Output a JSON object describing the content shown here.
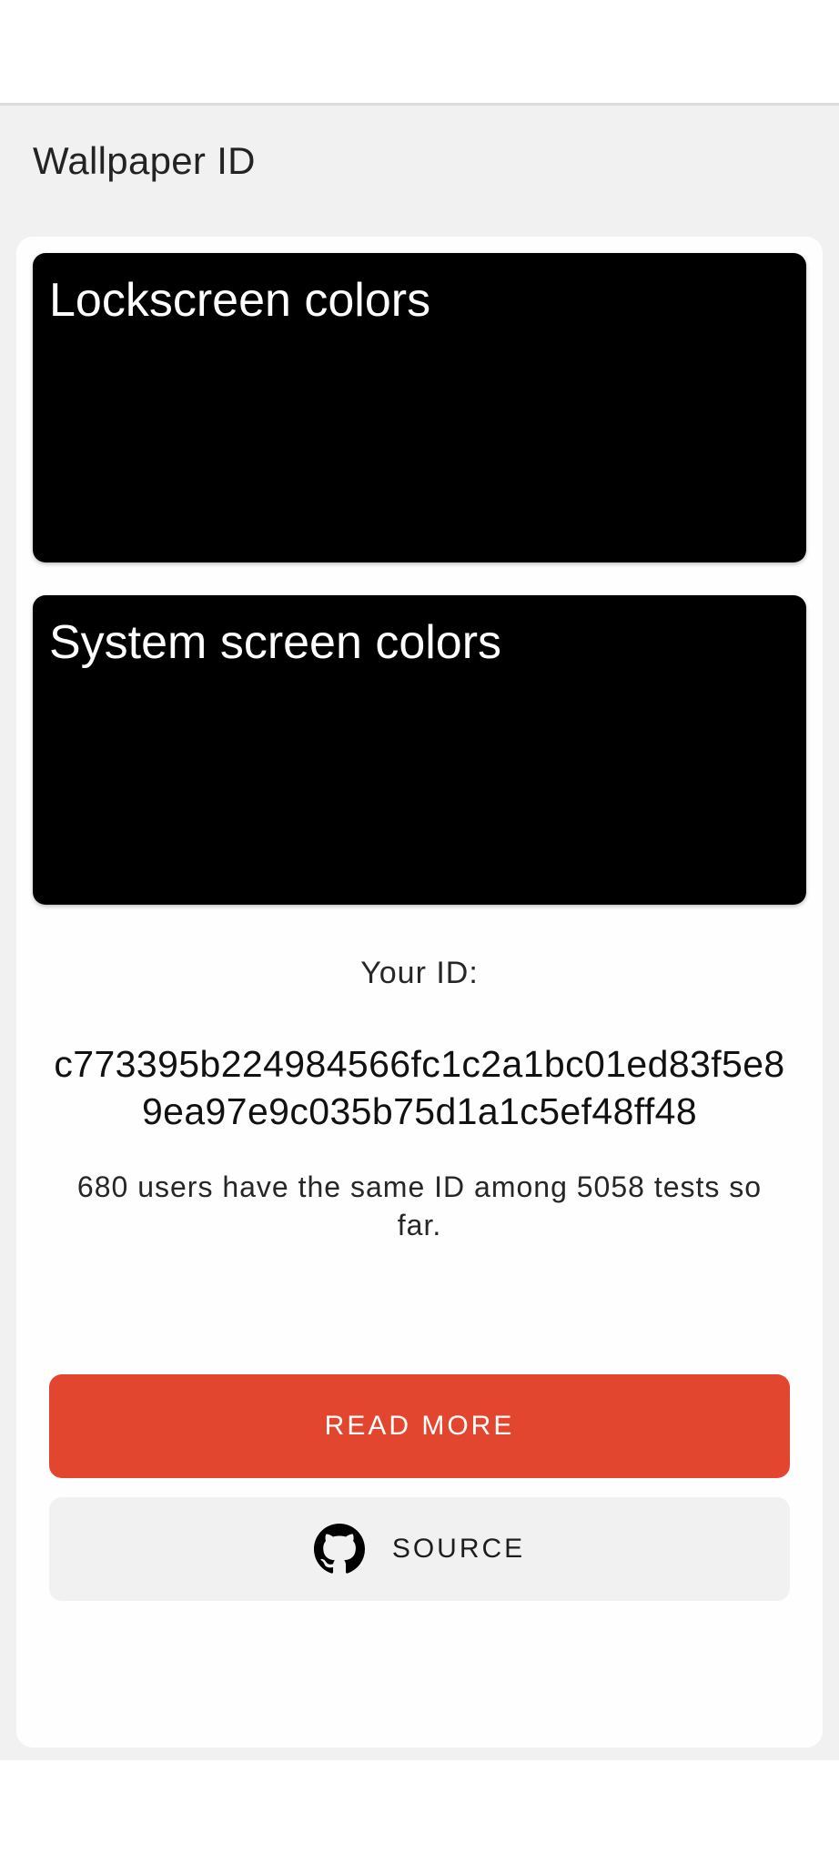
{
  "app": {
    "title": "Wallpaper ID"
  },
  "panels": {
    "lockscreen_title": "Lockscreen colors",
    "system_title": "System screen colors"
  },
  "id_section": {
    "label": "Your ID:",
    "value": "c773395b224984566fc1c2a1bc01ed83f5e89ea97e9c035b75d1a1c5ef48ff48",
    "stats": "680 users have the same ID among 5058 tests so far."
  },
  "buttons": {
    "read_more": "READ MORE",
    "source": "SOURCE",
    "source_icon": "github-icon"
  },
  "colors": {
    "accent": "#e2462e",
    "panel_background": "#000000",
    "page_background": "#f1f1f2",
    "card_background": "#fefefe"
  }
}
